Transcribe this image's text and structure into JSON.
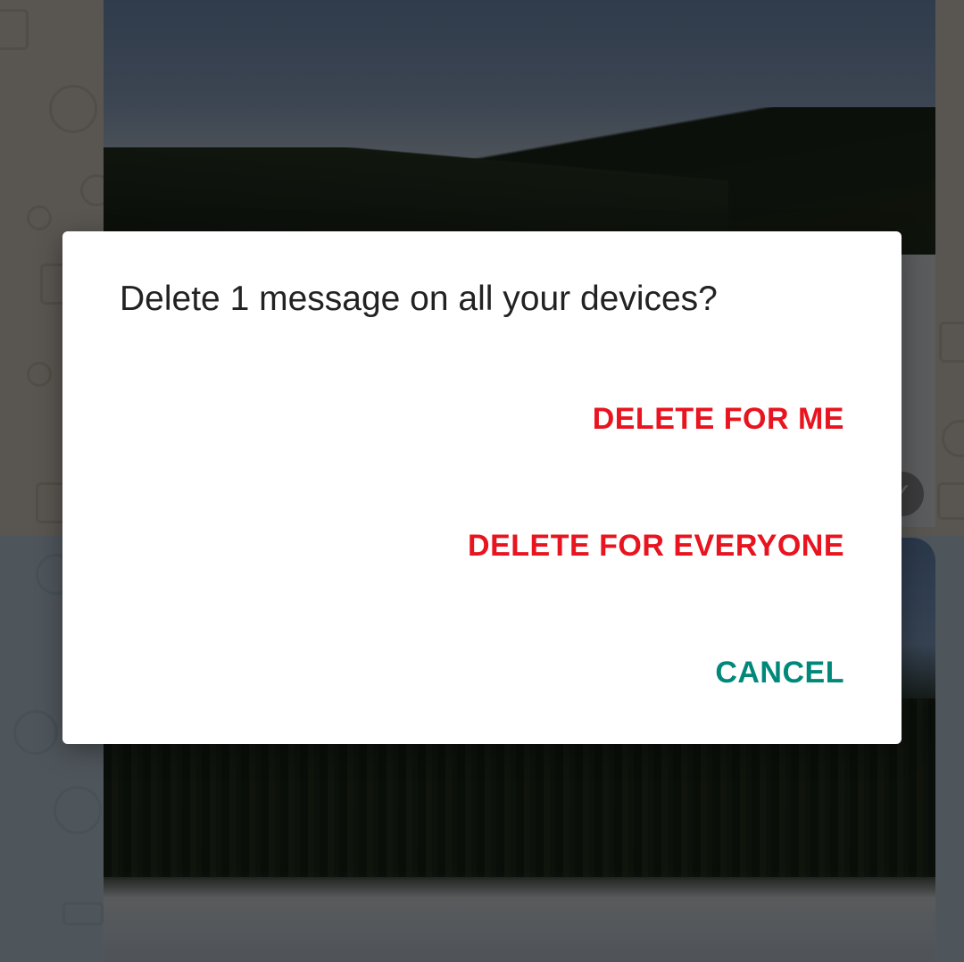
{
  "background": {
    "check_glyph": "✓"
  },
  "dialog": {
    "title": "Delete 1 message on all your devices?",
    "buttons": [
      {
        "label": "DELETE FOR ME",
        "color": "#e8141f"
      },
      {
        "label": "DELETE FOR EVERYONE",
        "color": "#e8141f"
      },
      {
        "label": "CANCEL",
        "color": "#00897b"
      }
    ]
  },
  "colors": {
    "destructive": "#e8141f",
    "accent": "#00897b",
    "title_text": "#222222",
    "dialog_background": "#ffffff",
    "scrim": "rgba(0,0,0,0.62)"
  }
}
